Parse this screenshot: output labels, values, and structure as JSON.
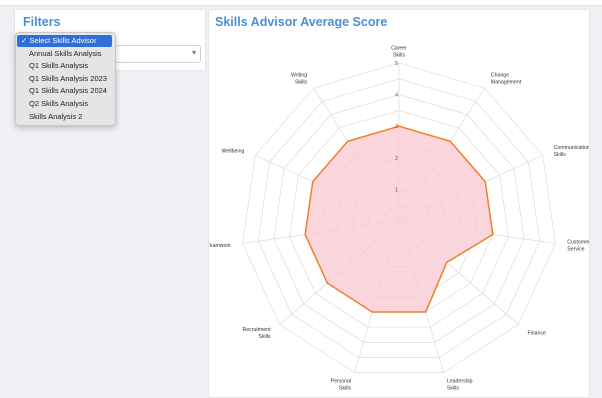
{
  "filters": {
    "title": "Filters",
    "dropdown_options": [
      {
        "label": "Select Skills Advisor",
        "selected": true
      },
      {
        "label": "Annual Skills Analysis",
        "selected": false
      },
      {
        "label": "Q1 Skills Analysis",
        "selected": false
      },
      {
        "label": "Q1 Skills Analysis 2023",
        "selected": false
      },
      {
        "label": "Q1 Skills Analysis 2024",
        "selected": false
      },
      {
        "label": "Q2 Skills Analysis",
        "selected": false
      },
      {
        "label": "Skills Analysis 2",
        "selected": false
      }
    ]
  },
  "chart": {
    "title": "Skills Advisor Average Score"
  },
  "colors": {
    "accent": "#4a90d6",
    "series_line": "#f07f2c",
    "series_fill": "#f9c9d1",
    "selected_option": "#2f6fd6"
  },
  "chart_data": {
    "type": "radar",
    "title": "Skills Advisor Average Score",
    "rmax": 5,
    "ticks": [
      "1",
      "2",
      "3",
      "4",
      "5"
    ],
    "categories": [
      {
        "line1": "Career",
        "line2": "Skills"
      },
      {
        "line1": "Change",
        "line2": "Management"
      },
      {
        "line1": "Communication",
        "line2": "Skills"
      },
      {
        "line1": "Customer",
        "line2": "Service"
      },
      {
        "line1": "Finance",
        "line2": ""
      },
      {
        "line1": "Leadership",
        "line2": "Skills"
      },
      {
        "line1": "Personal",
        "line2": "Skills"
      },
      {
        "line1": "Recruitment",
        "line2": "Skills"
      },
      {
        "line1": "Teamwork",
        "line2": ""
      },
      {
        "line1": "Wellbeing",
        "line2": ""
      },
      {
        "line1": "Writing",
        "line2": "Skills"
      }
    ],
    "series": [
      {
        "values": [
          3.0,
          3.0,
          3.0,
          3.0,
          2.0,
          3.0,
          3.0,
          3.0,
          3.0,
          3.0,
          3.0
        ]
      }
    ]
  }
}
